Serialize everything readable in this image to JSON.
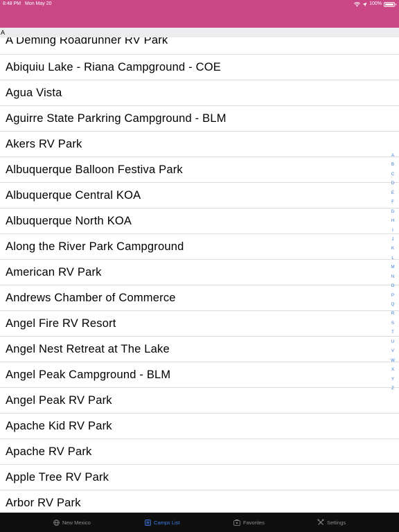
{
  "status_bar": {
    "time": "8:48 PM",
    "date": "Mon May 20",
    "battery": "100%",
    "icons": [
      "wifi-icon",
      "location-icon",
      "battery-icon"
    ]
  },
  "section_header": "A",
  "list": {
    "items": [
      "A Deming Roadrunner RV Park",
      "Abiquiu Lake - Riana Campground - COE",
      "Agua Vista",
      "Aguirre State Parkring Campground - BLM",
      "Akers RV Park",
      "Albuquerque Balloon Festiva Park",
      "Albuquerque Central KOA",
      "Albuquerque North KOA",
      "Along the River Park Campground",
      "American RV Park",
      "Andrews Chamber of Commerce",
      "Angel Fire RV Resort",
      "Angel Nest Retreat at The Lake",
      "Angel Peak Campground - BLM",
      "Angel Peak RV Park",
      "Apache Kid RV Park",
      "Apache RV Park",
      "Apple Tree RV Park",
      "Arbor RV Park"
    ]
  },
  "index_bar": [
    "A",
    "B",
    "C",
    "D",
    "E",
    "F",
    "G",
    "H",
    "I",
    "J",
    "K",
    "L",
    "M",
    "N",
    "O",
    "P",
    "Q",
    "R",
    "S",
    "T",
    "U",
    "V",
    "W",
    "X",
    "Y",
    "Z"
  ],
  "tabs": [
    {
      "label": "New Mexico",
      "icon": "globe-icon",
      "active": false
    },
    {
      "label": "Camps List",
      "icon": "list-icon",
      "active": true
    },
    {
      "label": "Favorites",
      "icon": "favorites-icon",
      "active": false
    },
    {
      "label": "Settings",
      "icon": "tools-icon",
      "active": false
    }
  ],
  "colors": {
    "header": "#c94784",
    "accent": "#3f7ee8",
    "index": "#2f73d9",
    "tab_bar": "#0f0f0f",
    "section_header": "#ececee"
  }
}
